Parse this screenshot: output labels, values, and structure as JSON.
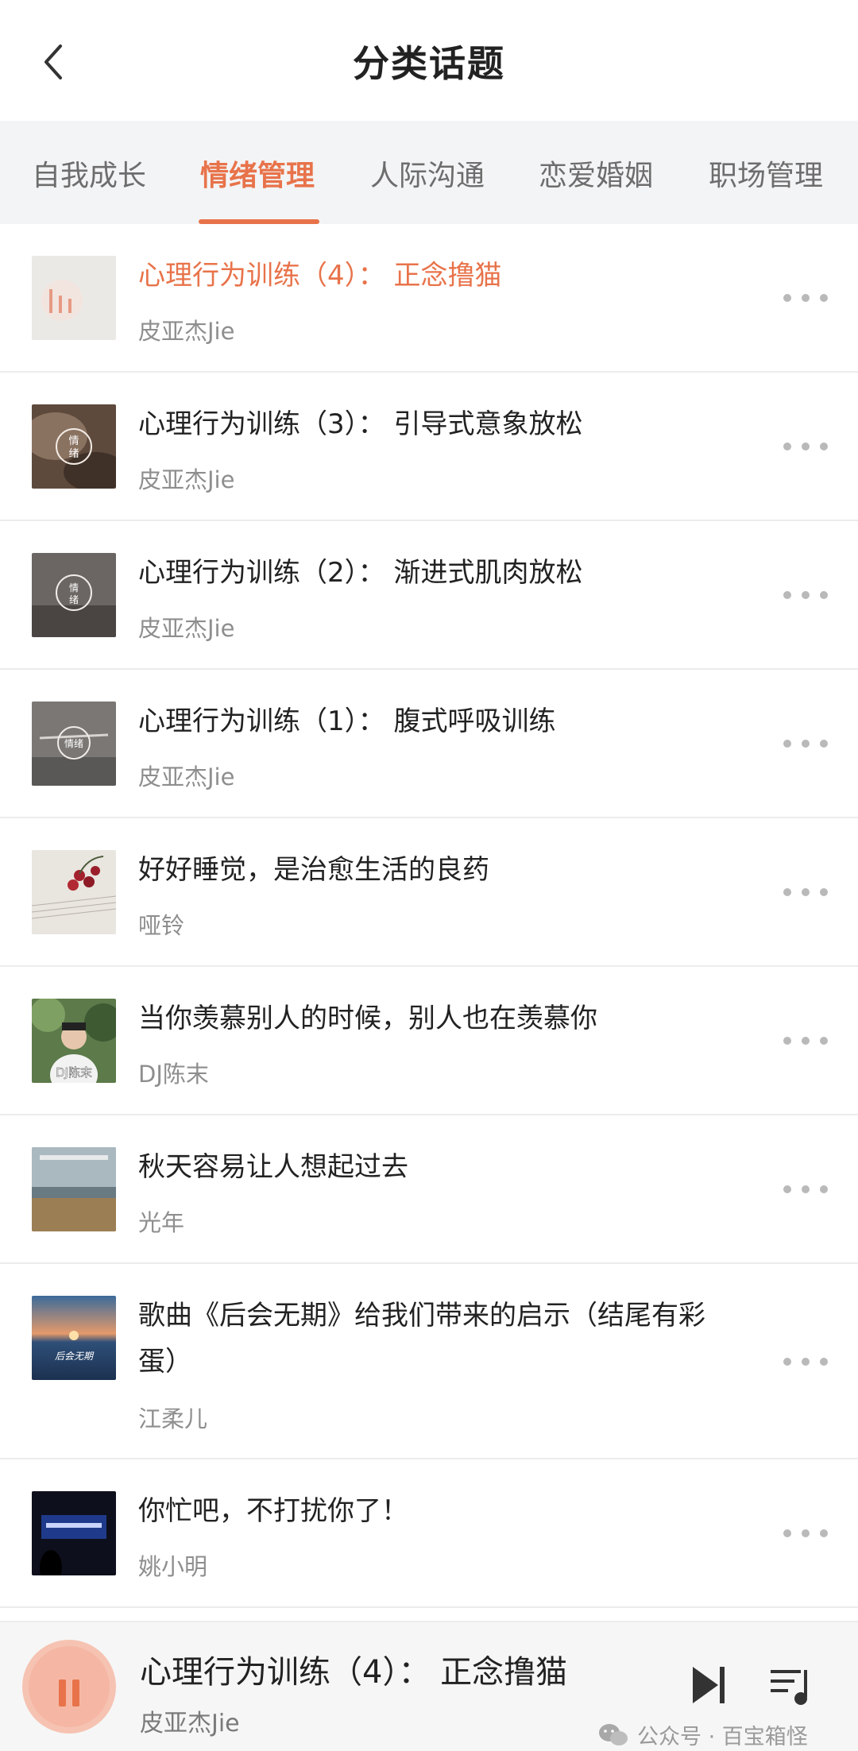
{
  "header": {
    "title": "分类话题"
  },
  "tabs": [
    {
      "label": "自我成长"
    },
    {
      "label": "情绪管理"
    },
    {
      "label": "人际沟通"
    },
    {
      "label": "恋爱婚姻"
    },
    {
      "label": "职场管理"
    }
  ],
  "active_tab": "情绪管理",
  "colors": {
    "accent": "#e8734a",
    "text": "#222222",
    "secondary": "#8e8e8e"
  },
  "items": [
    {
      "title": "心理行为训练（4）： 正念撸猫",
      "author": "皮亚杰Jie",
      "playing": true
    },
    {
      "title": "心理行为训练（3）： 引导式意象放松",
      "author": "皮亚杰Jie"
    },
    {
      "title": "心理行为训练（2）： 渐进式肌肉放松",
      "author": "皮亚杰Jie"
    },
    {
      "title": "心理行为训练（1）： 腹式呼吸训练",
      "author": "皮亚杰Jie"
    },
    {
      "title": "好好睡觉，是治愈生活的良药",
      "author": "哑铃"
    },
    {
      "title": "当你羡慕别人的时候，别人也在羡慕你",
      "author": "DJ陈末"
    },
    {
      "title": "秋天容易让人想起过去",
      "author": "光年"
    },
    {
      "title": "歌曲《后会无期》给我们带来的启示（结尾有彩蛋）",
      "author": "江柔儿"
    },
    {
      "title": "你忙吧，不打扰你了！",
      "author": "姚小明"
    }
  ],
  "thumb_text": {
    "t2": "情\n绪",
    "t3": "情\n绪",
    "t4": "情绪",
    "t6": "DJ陈末",
    "t8": "后会无期"
  },
  "player": {
    "title": "心理行为训练（4）： 正念撸猫",
    "author": "皮亚杰Jie",
    "state": "playing"
  },
  "watermark": {
    "text": "公众号 · 百宝箱怪"
  }
}
